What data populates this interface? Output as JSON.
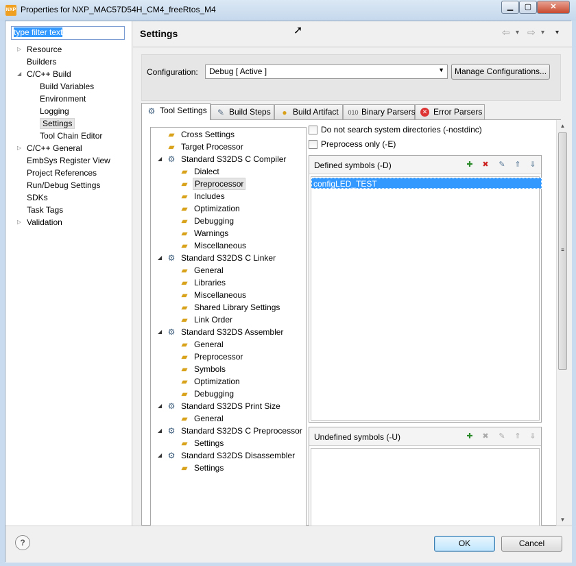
{
  "window": {
    "title": "Properties for NXP_MAC57D54H_CM4_freeRtos_M4",
    "logo_text": "NXP",
    "minimize_glyph": "▁",
    "maximize_glyph": "▢",
    "close_glyph": "✕"
  },
  "filter": {
    "value": "type filter text"
  },
  "nav": {
    "items": [
      {
        "label": "Resource",
        "expandable": true,
        "expanded": false
      },
      {
        "label": "Builders"
      },
      {
        "label": "C/C++ Build",
        "expandable": true,
        "expanded": true
      },
      {
        "label": "Build Variables"
      },
      {
        "label": "Environment"
      },
      {
        "label": "Logging"
      },
      {
        "label": "Settings",
        "selected": true
      },
      {
        "label": "Tool Chain Editor"
      },
      {
        "label": "C/C++ General",
        "expandable": true,
        "expanded": false
      },
      {
        "label": "EmbSys Register View"
      },
      {
        "label": "Project References"
      },
      {
        "label": "Run/Debug Settings"
      },
      {
        "label": "SDKs"
      },
      {
        "label": "Task Tags"
      },
      {
        "label": "Validation",
        "expandable": true,
        "expanded": false
      }
    ]
  },
  "header": {
    "title": "Settings",
    "back_glyph": "⇦",
    "forward_glyph": "⇨",
    "dropdown_glyph": "▾"
  },
  "configuration": {
    "label": "Configuration:",
    "value": "Debug  [ Active ]",
    "manage_label": "Manage Configurations..."
  },
  "tabs": [
    {
      "label": "Tool Settings",
      "icon": "tool-settings-icon",
      "active": true
    },
    {
      "label": "Build Steps",
      "icon": "build-steps-icon"
    },
    {
      "label": "Build Artifact",
      "icon": "build-artifact-icon"
    },
    {
      "label": "Binary Parsers",
      "icon": "binary-parsers-icon"
    },
    {
      "label": "Error Parsers",
      "icon": "error-parsers-icon"
    }
  ],
  "tool_tree": [
    {
      "label": "Cross Settings",
      "level": 0,
      "icon": "folder"
    },
    {
      "label": "Target Processor",
      "level": 0,
      "icon": "folder"
    },
    {
      "label": "Standard S32DS C Compiler",
      "level": 0,
      "icon": "tool",
      "expanded": true
    },
    {
      "label": "Dialect",
      "level": 1,
      "icon": "folder"
    },
    {
      "label": "Preprocessor",
      "level": 1,
      "icon": "folder",
      "selected": true
    },
    {
      "label": "Includes",
      "level": 1,
      "icon": "folder"
    },
    {
      "label": "Optimization",
      "level": 1,
      "icon": "folder"
    },
    {
      "label": "Debugging",
      "level": 1,
      "icon": "folder"
    },
    {
      "label": "Warnings",
      "level": 1,
      "icon": "folder"
    },
    {
      "label": "Miscellaneous",
      "level": 1,
      "icon": "folder"
    },
    {
      "label": "Standard S32DS C Linker",
      "level": 0,
      "icon": "tool",
      "expanded": true
    },
    {
      "label": "General",
      "level": 1,
      "icon": "folder"
    },
    {
      "label": "Libraries",
      "level": 1,
      "icon": "folder"
    },
    {
      "label": "Miscellaneous",
      "level": 1,
      "icon": "folder"
    },
    {
      "label": "Shared Library Settings",
      "level": 1,
      "icon": "folder"
    },
    {
      "label": "Link Order",
      "level": 1,
      "icon": "folder"
    },
    {
      "label": "Standard S32DS Assembler",
      "level": 0,
      "icon": "tool",
      "expanded": true
    },
    {
      "label": "General",
      "level": 1,
      "icon": "folder"
    },
    {
      "label": "Preprocessor",
      "level": 1,
      "icon": "folder"
    },
    {
      "label": "Symbols",
      "level": 1,
      "icon": "folder"
    },
    {
      "label": "Optimization",
      "level": 1,
      "icon": "folder"
    },
    {
      "label": "Debugging",
      "level": 1,
      "icon": "folder"
    },
    {
      "label": "Standard S32DS Print Size",
      "level": 0,
      "icon": "tool",
      "expanded": true
    },
    {
      "label": "General",
      "level": 1,
      "icon": "folder"
    },
    {
      "label": "Standard S32DS C Preprocessor",
      "level": 0,
      "icon": "tool",
      "expanded": true
    },
    {
      "label": "Settings",
      "level": 1,
      "icon": "folder"
    },
    {
      "label": "Standard S32DS Disassembler",
      "level": 0,
      "icon": "tool",
      "expanded": true
    },
    {
      "label": "Settings",
      "level": 1,
      "icon": "folder"
    }
  ],
  "options": {
    "no_sys_dirs": {
      "label": "Do not search system directories (-nostdinc)",
      "checked": false
    },
    "preprocess_only": {
      "label": "Preprocess only (-E)",
      "checked": false
    }
  },
  "defined_symbols": {
    "title": "Defined symbols (-D)",
    "items": [
      "configLED_TEST"
    ]
  },
  "undefined_symbols": {
    "title": "Undefined symbols (-U)",
    "items": []
  },
  "footer": {
    "help_glyph": "?",
    "ok_label": "OK",
    "cancel_label": "Cancel"
  }
}
